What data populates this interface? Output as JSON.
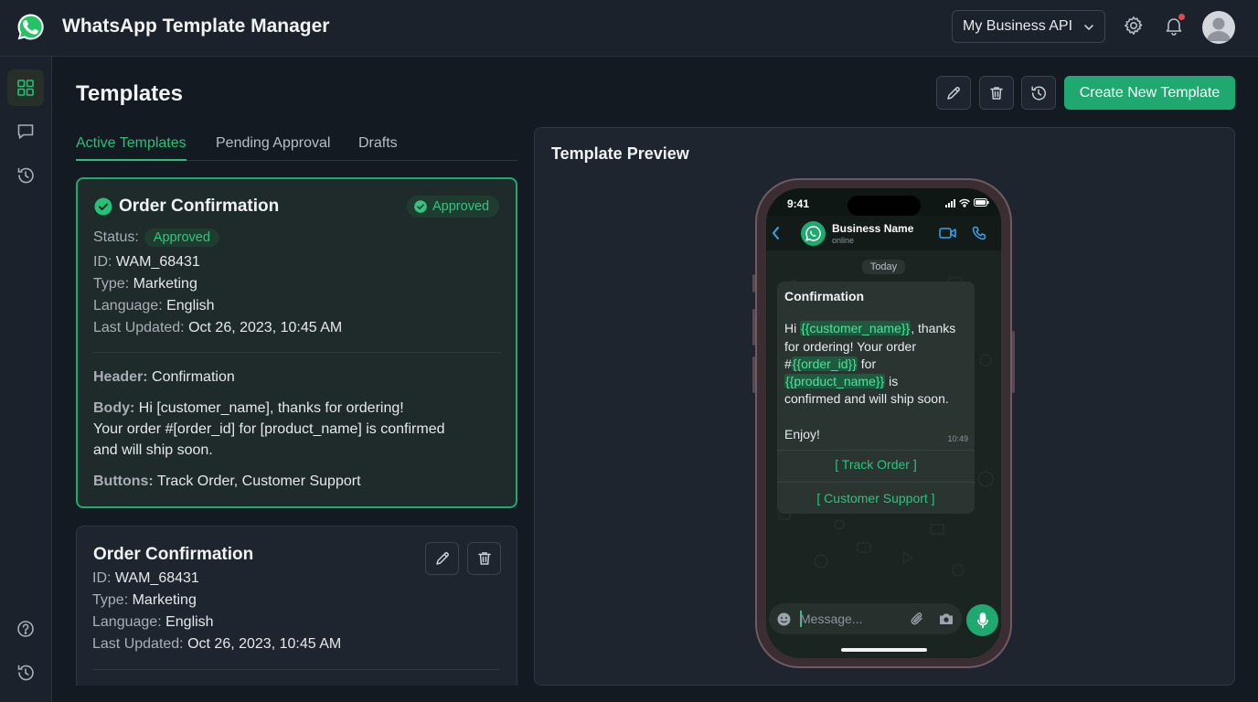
{
  "app": {
    "title": "WhatsApp Template Manager"
  },
  "header": {
    "account_select": "My Business API",
    "icons": [
      "settings-icon",
      "bell-icon",
      "avatar"
    ]
  },
  "rail": {
    "icons": [
      "grid-icon",
      "chat-icon",
      "history-icon",
      "help-icon",
      "history-icon"
    ]
  },
  "page": {
    "title": "Templates",
    "create_button": "Create New Template"
  },
  "tabs": [
    {
      "label": "Active Templates",
      "active": true
    },
    {
      "label": "Pending Approval",
      "active": false
    },
    {
      "label": "Drafts",
      "active": false
    }
  ],
  "cards": [
    {
      "title": "Order Confirmation",
      "badge": "Approved",
      "status_label": "Status:",
      "status_value": "Approved",
      "id_label": "ID:",
      "id": "WAM_68431",
      "type_label": "Type:",
      "type": "Marketing",
      "language_label": "Language:",
      "language": "English",
      "updated_label": "Last Updated:",
      "updated": "Oct 26, 2023, 10:45 AM",
      "header_label": "Header:",
      "header": "Confirmation",
      "body_label": "Body:",
      "body_line1": "Hi [customer_name], thanks for ordering!",
      "body_line2": "Your order #[order_id] for [product_name] is confirmed",
      "body_line3": "and will ship soon.",
      "buttons_label": "Buttons:",
      "buttons": "Track Order, Customer Support"
    },
    {
      "title": "Order Confirmation",
      "id_label": "ID:",
      "id": "WAM_68431",
      "type_label": "Type:",
      "type": "Marketing",
      "language_label": "Language:",
      "language": "English",
      "updated_label": "Last Updated:",
      "updated": "Oct 26, 2023, 10:45 AM"
    }
  ],
  "preview": {
    "title": "Template Preview",
    "phone": {
      "time": "9:41",
      "contact_name": "Business Name",
      "contact_status": "online",
      "date_chip": "Today",
      "message": {
        "header": "Confirmation",
        "line1_a": "Hi ",
        "line1_var": "{{customer_name}}",
        "line1_b": ", thanks",
        "line2": "for ordering! Your order",
        "line3_a": "#",
        "line3_var": "{{order_id}}",
        "line3_b": " for",
        "line4_var": "{{product_name}}",
        "line4_b": " is",
        "line5": "confirmed and will ship soon.",
        "line6": "Enjoy!",
        "time": "10:49",
        "button1": "[ Track Order ]",
        "button2": "[ Customer Support ]"
      },
      "input_placeholder": "Message..."
    }
  },
  "colors": {
    "accent": "#1fa870",
    "accent_text": "#25c178",
    "background": "#141a22",
    "panel": "#1e252e"
  }
}
